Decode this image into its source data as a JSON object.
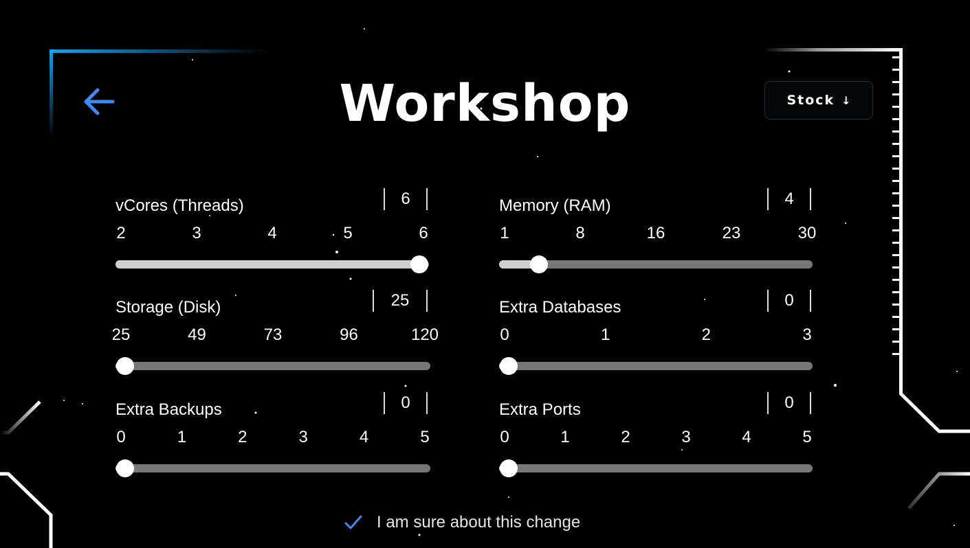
{
  "header": {
    "title": "Workshop",
    "stock_label": "Stock",
    "stock_arrow": "↓",
    "back_icon": "arrow-left-icon"
  },
  "colors": {
    "accent": "#3d8bf2",
    "frame_blue": "#1aa3e8",
    "track": "#777777",
    "track_fill": "#cfcfcf",
    "thumb": "#ffffff",
    "background": "#000000"
  },
  "sliders": [
    {
      "label": "vCores (Threads)",
      "value": "6",
      "ticks": [
        "2",
        "3",
        "4",
        "5",
        "6"
      ],
      "min": 2,
      "max": 6,
      "current": 6
    },
    {
      "label": "Memory (RAM)",
      "value": "4",
      "ticks": [
        "1",
        "8",
        "16",
        "23",
        "30"
      ],
      "min": 1,
      "max": 30,
      "current": 4
    },
    {
      "label": "Storage (Disk)",
      "value": "25",
      "ticks": [
        "25",
        "49",
        "73",
        "96",
        "120"
      ],
      "min": 25,
      "max": 120,
      "current": 25
    },
    {
      "label": "Extra Databases",
      "value": "0",
      "ticks": [
        "0",
        "1",
        "2",
        "3"
      ],
      "min": 0,
      "max": 3,
      "current": 0
    },
    {
      "label": "Extra Backups",
      "value": "0",
      "ticks": [
        "0",
        "1",
        "2",
        "3",
        "4",
        "5"
      ],
      "min": 0,
      "max": 5,
      "current": 0
    },
    {
      "label": "Extra Ports",
      "value": "0",
      "ticks": [
        "0",
        "1",
        "2",
        "3",
        "4",
        "5"
      ],
      "min": 0,
      "max": 5,
      "current": 0
    }
  ],
  "confirm": {
    "label": "I am sure about this change",
    "checked": true,
    "icon": "check-icon"
  }
}
